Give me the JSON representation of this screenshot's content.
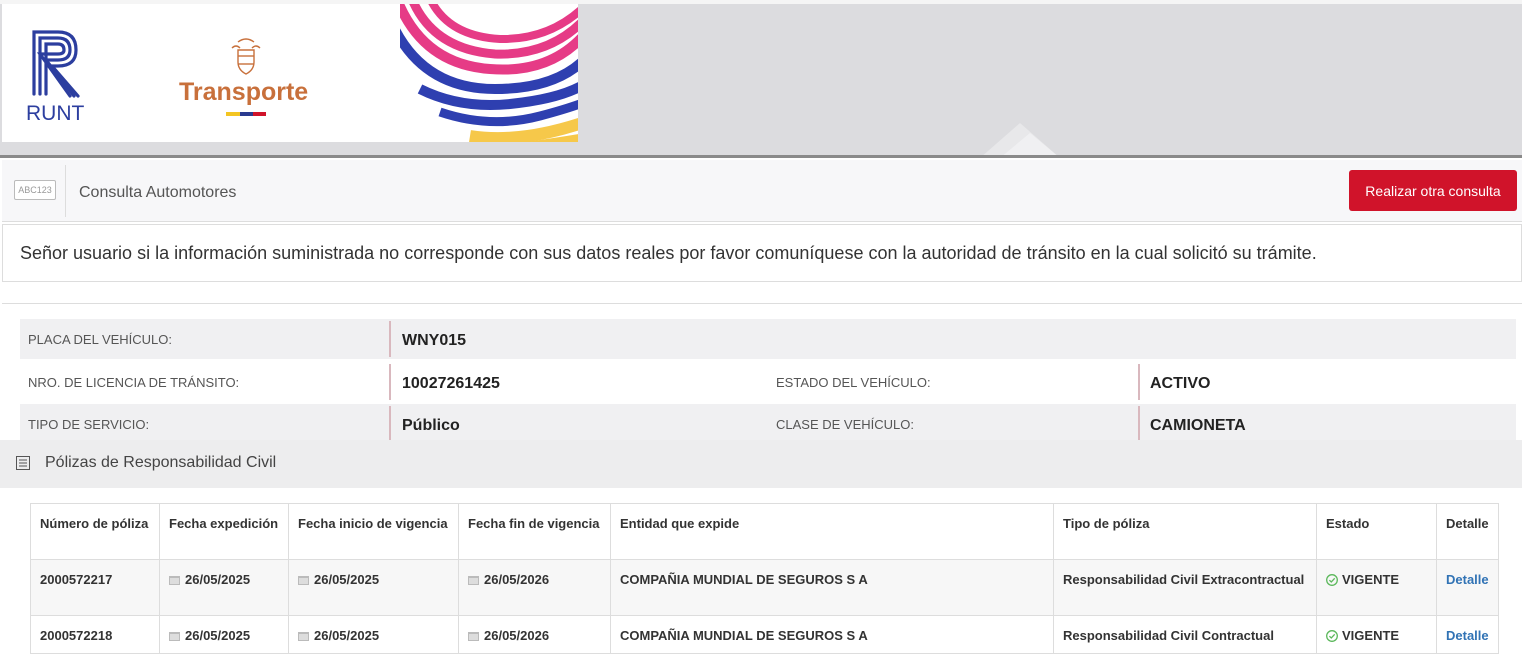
{
  "header": {
    "runt_logo_text": "RUNT",
    "ministry_text": "Transporte"
  },
  "consulta": {
    "icon_text": "ABC123",
    "title": "Consulta Automotores",
    "button_label": "Realizar otra consulta"
  },
  "notice": {
    "text": "Señor usuario si la información suministrada no corresponde con sus datos reales por favor comuníquese con la autoridad de tránsito en la cual solicitó su trámite."
  },
  "vehicle": {
    "placa_label": "PLACA DEL VEHÍCULO:",
    "placa_value": "WNY015",
    "licencia_label": "NRO. DE LICENCIA DE TRÁNSITO:",
    "licencia_value": "10027261425",
    "estado_label": "ESTADO DEL VEHÍCULO:",
    "estado_value": "ACTIVO",
    "servicio_label": "TIPO DE SERVICIO:",
    "servicio_value": "Público",
    "clase_label": "CLASE DE VEHÍCULO:",
    "clase_value": "CAMIONETA"
  },
  "polizas": {
    "section_title": "Pólizas de Responsabilidad Civil",
    "columns": [
      "Número de póliza",
      "Fecha expedición",
      "Fecha inicio de vigencia",
      "Fecha fin de vigencia",
      "Entidad que expide",
      "Tipo de póliza",
      "Estado",
      "Detalle"
    ],
    "rows": [
      {
        "numero": "2000572217",
        "expedicion": "26/05/2025",
        "inicio": "26/05/2025",
        "fin": "26/05/2026",
        "entidad": "COMPAÑIA MUNDIAL DE SEGUROS S A",
        "tipo": "Responsabilidad Civil Extracontractual",
        "estado": "VIGENTE",
        "detalle": "Detalle"
      },
      {
        "numero": "2000572218",
        "expedicion": "26/05/2025",
        "inicio": "26/05/2025",
        "fin": "26/05/2026",
        "entidad": "COMPAÑIA MUNDIAL DE SEGUROS S A",
        "tipo": "Responsabilidad Civil Contractual",
        "estado": "VIGENTE",
        "detalle": "Detalle"
      }
    ]
  },
  "colors": {
    "accent_red": "#d0132a",
    "runt_blue": "#2c3e9f",
    "transporte_orange": "#c8703b",
    "link_blue": "#3173b5",
    "vigente_green": "#5cb85c"
  }
}
